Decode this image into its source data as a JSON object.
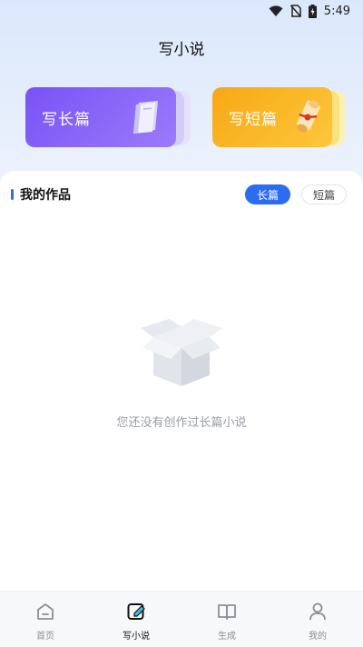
{
  "status_bar": {
    "time": "5:49",
    "icons": [
      "wifi-icon",
      "no-sim-icon",
      "battery-charging-icon"
    ]
  },
  "page": {
    "title": "写小说"
  },
  "cards": {
    "long": {
      "label": "写长篇",
      "icon": "book-icon",
      "color": "#7a52f6"
    },
    "short": {
      "label": "写短篇",
      "icon": "scroll-icon",
      "color": "#f7a816"
    }
  },
  "works": {
    "title": "我的作品",
    "accent_color": "#2f6ef6",
    "tabs": [
      {
        "label": "长篇",
        "active": true
      },
      {
        "label": "短篇",
        "active": false
      }
    ],
    "empty_icon": "empty-box-icon",
    "empty_text": "您还没有创作过长篇小说"
  },
  "bottom_nav": {
    "items": [
      {
        "label": "首页",
        "icon": "home-icon",
        "active": false
      },
      {
        "label": "写小说",
        "icon": "edit-icon",
        "active": true
      },
      {
        "label": "生成",
        "icon": "open-book-icon",
        "active": false
      },
      {
        "label": "我的",
        "icon": "person-icon",
        "active": false
      }
    ]
  }
}
